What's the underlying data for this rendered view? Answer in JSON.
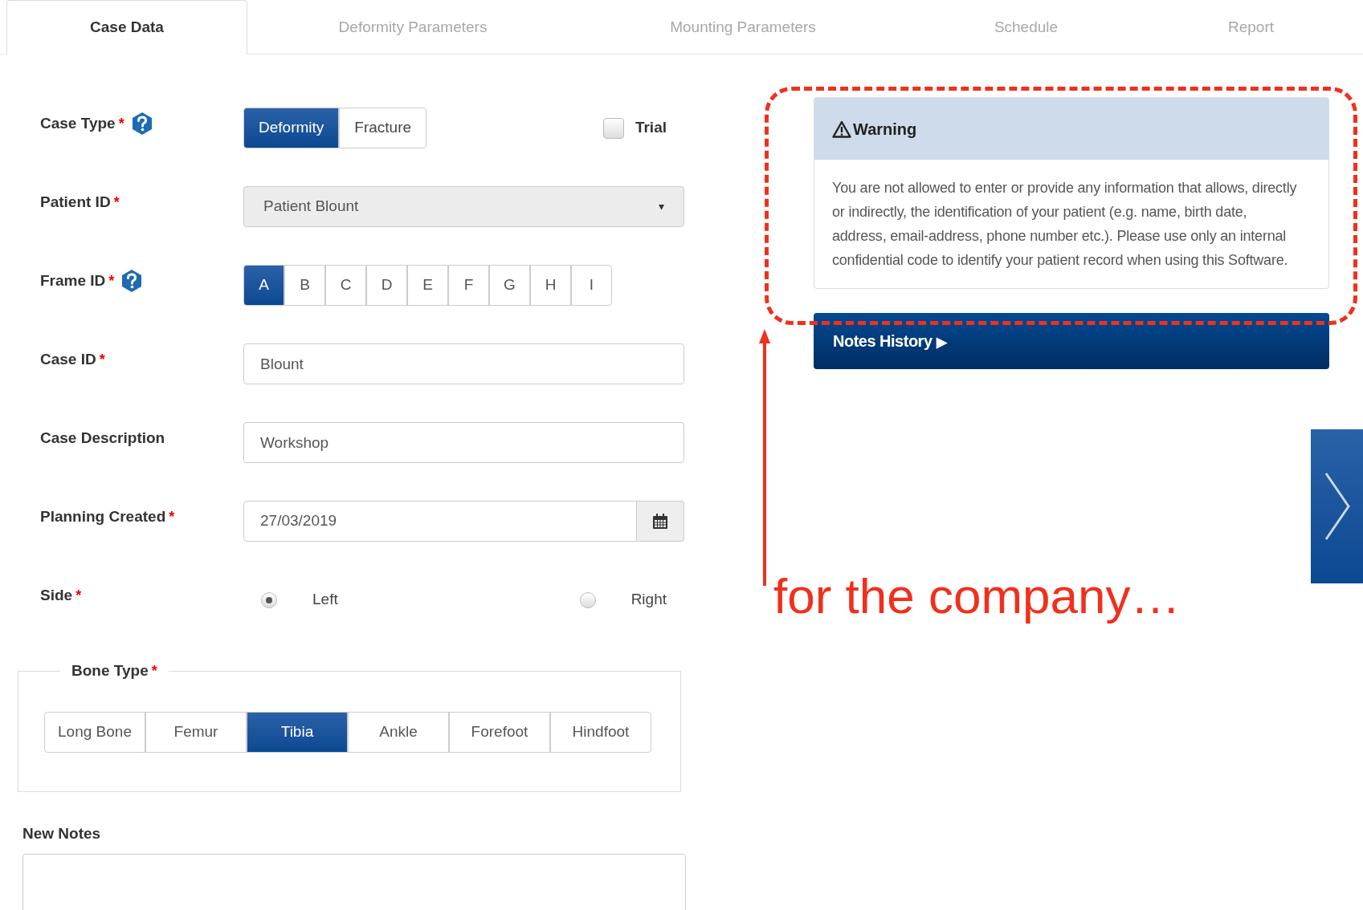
{
  "tabs": [
    {
      "label": "Case Data",
      "selected": true
    },
    {
      "label": "Deformity Parameters",
      "selected": false
    },
    {
      "label": "Mounting Parameters",
      "selected": false
    },
    {
      "label": "Schedule",
      "selected": false
    },
    {
      "label": "Report",
      "selected": false
    }
  ],
  "fields": [
    {
      "kind": "toggle",
      "label": "Case Type",
      "required_mark": "*",
      "help": true,
      "options": [
        {
          "label": "Deformity",
          "selected": true
        },
        {
          "label": "Fracture",
          "selected": false
        }
      ],
      "trial": {
        "label": "Trial",
        "checked": false
      }
    },
    {
      "kind": "select",
      "label": "Patient ID",
      "required_mark": "*",
      "help": false,
      "value": "Patient Blount",
      "caret": "▾"
    },
    {
      "kind": "segmented",
      "label": "Frame ID",
      "required_mark": "*",
      "help": true,
      "options": [
        {
          "label": "A",
          "selected": true
        },
        {
          "label": "B",
          "selected": false
        },
        {
          "label": "C",
          "selected": false
        },
        {
          "label": "D",
          "selected": false
        },
        {
          "label": "E",
          "selected": false
        },
        {
          "label": "F",
          "selected": false
        },
        {
          "label": "G",
          "selected": false
        },
        {
          "label": "H",
          "selected": false
        },
        {
          "label": "I",
          "selected": false
        }
      ]
    },
    {
      "kind": "text",
      "label": "Case ID",
      "required_mark": "*",
      "help": false,
      "value": "Blount"
    },
    {
      "kind": "text",
      "label": "Case Description",
      "help": false,
      "value": "Workshop"
    },
    {
      "kind": "date",
      "label": "Planning Created",
      "required_mark": "*",
      "help": false,
      "value": "27/03/2019"
    },
    {
      "kind": "radio",
      "label": "Side",
      "required_mark": "*",
      "help": false,
      "options": [
        {
          "label": "Left",
          "selected": true
        },
        {
          "label": "Right",
          "selected": false
        }
      ]
    }
  ],
  "bone_type": {
    "legend": "Bone Type",
    "required_mark": "*",
    "options": [
      {
        "label": "Long Bone",
        "selected": false
      },
      {
        "label": "Femur",
        "selected": false
      },
      {
        "label": "Tibia",
        "selected": true
      },
      {
        "label": "Ankle",
        "selected": false
      },
      {
        "label": "Forefoot",
        "selected": false
      },
      {
        "label": "Hindfoot",
        "selected": false
      }
    ]
  },
  "new_notes": {
    "label": "New Notes"
  },
  "warning": {
    "title": "Warning",
    "body": "You are not allowed to enter or provide any information that allows, directly or indirectly, the identification of your patient (e.g. name, birth date, address, email-address, phone number etc.). Please use only an internal confidential code to identify your patient record when using this Software."
  },
  "notes_history": {
    "label": "Notes History",
    "arrow": "▶"
  },
  "annotation": {
    "text": "for the company…"
  }
}
